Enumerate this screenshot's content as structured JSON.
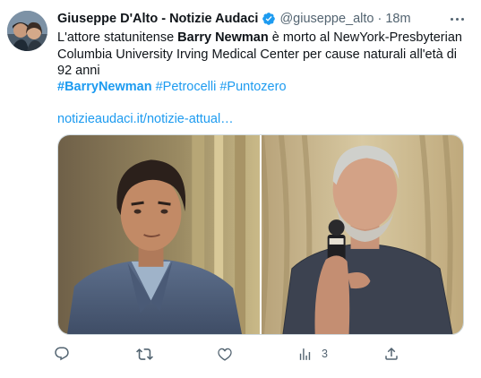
{
  "tweet": {
    "author_name": "Giuseppe D'Alto - Notizie Audaci",
    "handle": "@giuseppe_alto",
    "separator": "·",
    "time": "18m",
    "text_before": "L'attore statunitense ",
    "text_bold": "Barry Newman",
    "text_after": " è morto al NewYork-Presbyterian Columbia University Irving Medical Center per cause naturali all'età di 92 anni",
    "hashtags": [
      "#BarryNewman",
      "#Petrocelli",
      "#Puntozero"
    ],
    "link": "notizieaudaci.it/notizie-attual…",
    "views_count": "3"
  },
  "icons": {
    "verified": "verified-badge-icon",
    "more": "more-options-icon",
    "reply": "reply-icon",
    "retweet": "retweet-icon",
    "like": "like-icon",
    "views": "views-icon",
    "share": "share-icon"
  },
  "colors": {
    "link": "#1d9bf0",
    "secondary_text": "#536471",
    "primary_text": "#0f1419",
    "verified": "#1d9bf0"
  }
}
